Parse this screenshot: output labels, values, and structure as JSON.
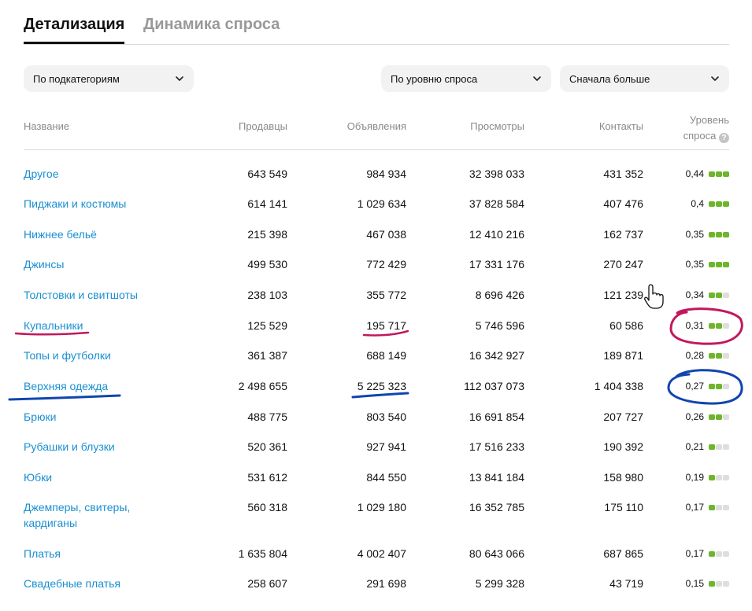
{
  "tabs": [
    {
      "label": "Детализация",
      "active": true
    },
    {
      "label": "Динамика спроса",
      "active": false
    }
  ],
  "filters": {
    "group_by": "По подкатегориям",
    "demand_filter": "По уровню спроса",
    "sort": "Сначала больше"
  },
  "table": {
    "columns": {
      "name": "Название",
      "sellers": "Продавцы",
      "ads": "Объявления",
      "views": "Просмотры",
      "contacts": "Контакты",
      "level_line1": "Уровень",
      "level_line2": "спроса"
    },
    "rows": [
      {
        "name": "Другое",
        "sellers": "643 549",
        "ads": "984 934",
        "views": "32 398 033",
        "contacts": "431 352",
        "level": "0,44",
        "level_dots": 3
      },
      {
        "name": "Пиджаки и костюмы",
        "sellers": "614 141",
        "ads": "1 029 634",
        "views": "37 828 584",
        "contacts": "407 476",
        "level": "0,4",
        "level_dots": 3
      },
      {
        "name": "Нижнее бельё",
        "sellers": "215 398",
        "ads": "467 038",
        "views": "12 410 216",
        "contacts": "162 737",
        "level": "0,35",
        "level_dots": 3
      },
      {
        "name": "Джинсы",
        "sellers": "499 530",
        "ads": "772 429",
        "views": "17 331 176",
        "contacts": "270 247",
        "level": "0,35",
        "level_dots": 3
      },
      {
        "name": "Толстовки и свитшоты",
        "sellers": "238 103",
        "ads": "355 772",
        "views": "8 696 426",
        "contacts": "121 239",
        "level": "0,34",
        "level_dots": 2
      },
      {
        "name": "Купальники",
        "sellers": "125 529",
        "ads": "195 717",
        "views": "5 746 596",
        "contacts": "60 586",
        "level": "0,31",
        "level_dots": 2
      },
      {
        "name": "Топы и футболки",
        "sellers": "361 387",
        "ads": "688 149",
        "views": "16 342 927",
        "contacts": "189 871",
        "level": "0,28",
        "level_dots": 2
      },
      {
        "name": "Верхняя одежда",
        "sellers": "2 498 655",
        "ads": "5 225 323",
        "views": "112 037 073",
        "contacts": "1 404 338",
        "level": "0,27",
        "level_dots": 2
      },
      {
        "name": "Брюки",
        "sellers": "488 775",
        "ads": "803 540",
        "views": "16 691 854",
        "contacts": "207 727",
        "level": "0,26",
        "level_dots": 2
      },
      {
        "name": "Рубашки и блузки",
        "sellers": "520 361",
        "ads": "927 941",
        "views": "17 516 233",
        "contacts": "190 392",
        "level": "0,21",
        "level_dots": 1
      },
      {
        "name": "Юбки",
        "sellers": "531 612",
        "ads": "844 550",
        "views": "13 841 184",
        "contacts": "158 980",
        "level": "0,19",
        "level_dots": 1
      },
      {
        "name": "Джемперы, свитеры, кардиганы",
        "sellers": "560 318",
        "ads": "1 029 180",
        "views": "16 352 785",
        "contacts": "175 110",
        "level": "0,17",
        "level_dots": 1
      },
      {
        "name": "Платья",
        "sellers": "1 635 804",
        "ads": "4 002 407",
        "views": "80 643 066",
        "contacts": "687 865",
        "level": "0,17",
        "level_dots": 1
      },
      {
        "name": "Свадебные платья",
        "sellers": "258 607",
        "ads": "291 698",
        "views": "5 299 328",
        "contacts": "43 719",
        "level": "0,15",
        "level_dots": 1
      }
    ]
  },
  "help_glyph": "?",
  "icons": {
    "dropdown": "chevron-down-icon",
    "help": "question-icon",
    "cursor": "hand-pointer-icon"
  },
  "colors": {
    "link": "#1a8fd1",
    "dot_on": "#6db52a",
    "dot_off": "#dedede",
    "anno_red": "#c2185b",
    "anno_blue": "#1045b0"
  }
}
